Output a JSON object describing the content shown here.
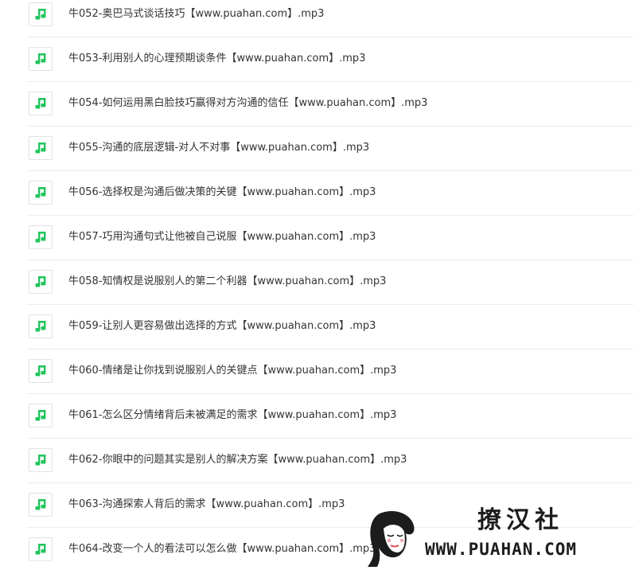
{
  "files": [
    {
      "name": "牛052-奥巴马式谈话技巧【www.puahan.com】.mp3",
      "icon": "music-note-icon"
    },
    {
      "name": "牛053-利用别人的心理预期谈条件【www.puahan.com】.mp3",
      "icon": "music-note-icon"
    },
    {
      "name": "牛054-如何运用黑白脸技巧赢得对方沟通的信任【www.puahan.com】.mp3",
      "icon": "music-note-icon"
    },
    {
      "name": "牛055-沟通的底层逻辑-对人不对事【www.puahan.com】.mp3",
      "icon": "music-note-icon"
    },
    {
      "name": "牛056-选择权是沟通后做决策的关键【www.puahan.com】.mp3",
      "icon": "music-note-icon"
    },
    {
      "name": "牛057-巧用沟通句式让他被自己说服【www.puahan.com】.mp3",
      "icon": "music-note-icon"
    },
    {
      "name": "牛058-知情权是说服别人的第二个利器【www.puahan.com】.mp3",
      "icon": "music-note-icon"
    },
    {
      "name": "牛059-让别人更容易做出选择的方式【www.puahan.com】.mp3",
      "icon": "music-note-icon"
    },
    {
      "name": "牛060-情绪是让你找到说服别人的关键点【www.puahan.com】.mp3",
      "icon": "music-note-icon"
    },
    {
      "name": "牛061-怎么区分情绪背后未被满足的需求【www.puahan.com】.mp3",
      "icon": "music-note-icon"
    },
    {
      "name": "牛062-你眼中的问题其实是别人的解决方案【www.puahan.com】.mp3",
      "icon": "music-note-icon"
    },
    {
      "name": "牛063-沟通探索人背后的需求【www.puahan.com】.mp3",
      "icon": "music-note-icon"
    },
    {
      "name": "牛064-改变一个人的看法可以怎么做【www.puahan.com】.mp3",
      "icon": "music-note-icon"
    }
  ],
  "watermark": {
    "brand": "撩汉社",
    "url": "WWW.PUAHAN.COM"
  },
  "colors": {
    "icon_accent": "#21c55d",
    "text": "#333333",
    "divider": "#ececec"
  }
}
